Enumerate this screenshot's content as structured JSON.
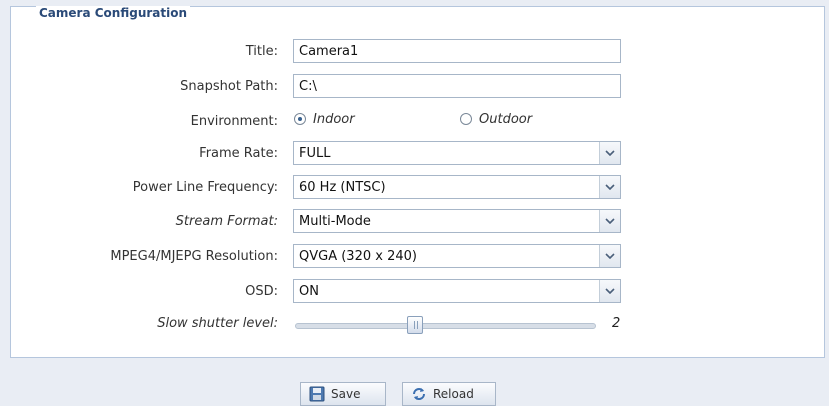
{
  "section": {
    "title": "Camera Configuration"
  },
  "form": {
    "title": {
      "label": "Title:",
      "value": "Camera1"
    },
    "snapshot_path": {
      "label": "Snapshot Path:",
      "value": "C:\\"
    },
    "environment": {
      "label": "Environment:",
      "options": [
        {
          "label": "Indoor",
          "selected": true
        },
        {
          "label": "Outdoor",
          "selected": false
        }
      ]
    },
    "frame_rate": {
      "label": "Frame Rate:",
      "value": "FULL"
    },
    "power_line_frequency": {
      "label": "Power Line Frequency:",
      "value": "60 Hz (NTSC)"
    },
    "stream_format": {
      "label": "Stream Format:",
      "value": "Multi-Mode"
    },
    "resolution": {
      "label": "MPEG4/MJEPG Resolution:",
      "value": "QVGA (320 x 240)"
    },
    "osd": {
      "label": "OSD:",
      "value": "ON"
    },
    "slow_shutter": {
      "label": "Slow shutter level:",
      "value": "2",
      "level_fraction": 0.4
    }
  },
  "buttons": {
    "save": "Save",
    "reload": "Reload"
  },
  "icons": {
    "dropdown": "chevron-down-icon",
    "save": "floppy-disk-icon",
    "reload": "refresh-icon"
  },
  "colors": {
    "panel_border": "#b5c6dd",
    "title": "#2a4a78",
    "background": "#e9edf4"
  }
}
